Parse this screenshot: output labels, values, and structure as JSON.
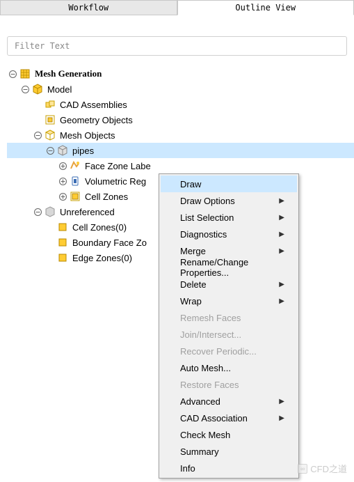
{
  "tabs": {
    "workflow": "Workflow",
    "outline": "Outline View"
  },
  "filter_placeholder": "Filter Text",
  "tree": {
    "root": "Mesh Generation",
    "model": "Model",
    "cad_assemblies": "CAD Assemblies",
    "geometry_objects": "Geometry Objects",
    "mesh_objects": "Mesh Objects",
    "pipes": "pipes",
    "face_zone_labels": "Face Zone Labe",
    "volumetric_regions": "Volumetric Reg",
    "cell_zones_node": "Cell Zones",
    "unreferenced": "Unreferenced",
    "cell_zones0": "Cell Zones(0)",
    "boundary_face_zones": "Boundary Face Zo",
    "edge_zones0": "Edge Zones(0)"
  },
  "menu": {
    "items": [
      {
        "label": "Draw",
        "arrow": false,
        "disabled": false,
        "hover": true
      },
      {
        "label": "Draw Options",
        "arrow": true,
        "disabled": false
      },
      {
        "label": "List Selection",
        "arrow": true,
        "disabled": false
      },
      {
        "label": "Diagnostics",
        "arrow": true,
        "disabled": false
      },
      {
        "label": "Merge",
        "arrow": true,
        "disabled": false
      },
      {
        "label": "Rename/Change Properties...",
        "arrow": false,
        "disabled": false
      },
      {
        "label": "Delete",
        "arrow": true,
        "disabled": false
      },
      {
        "label": "Wrap",
        "arrow": true,
        "disabled": false
      },
      {
        "label": "Remesh Faces",
        "arrow": false,
        "disabled": true
      },
      {
        "label": "Join/Intersect...",
        "arrow": false,
        "disabled": true
      },
      {
        "label": "Recover Periodic...",
        "arrow": false,
        "disabled": true
      },
      {
        "label": "Auto Mesh...",
        "arrow": false,
        "disabled": false
      },
      {
        "label": "Restore Faces",
        "arrow": false,
        "disabled": true
      },
      {
        "label": "Advanced",
        "arrow": true,
        "disabled": false
      },
      {
        "label": "CAD Association",
        "arrow": true,
        "disabled": false
      },
      {
        "label": "Check Mesh",
        "arrow": false,
        "disabled": false
      },
      {
        "label": "Summary",
        "arrow": false,
        "disabled": false
      },
      {
        "label": "Info",
        "arrow": false,
        "disabled": false
      }
    ]
  },
  "watermark": "CFD之道"
}
